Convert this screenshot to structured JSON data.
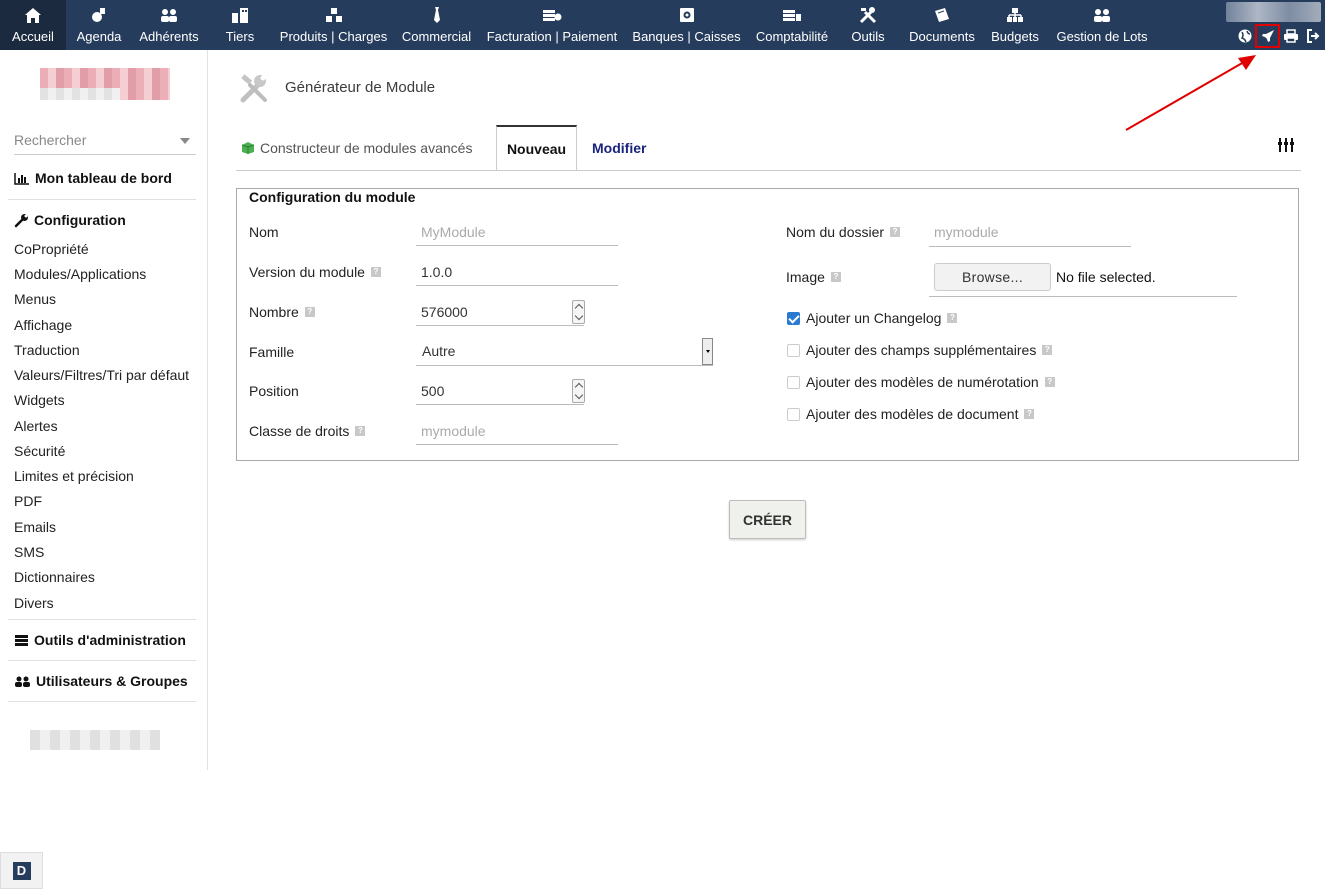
{
  "topbar": {
    "menu": [
      {
        "label": "Accueil",
        "icon": "home-icon"
      },
      {
        "label": "Agenda",
        "icon": "agenda-icon"
      },
      {
        "label": "Adhérents",
        "icon": "members-icon"
      },
      {
        "label": "Tiers",
        "icon": "building-icon"
      },
      {
        "label": "Produits | Charges",
        "icon": "products-icon"
      },
      {
        "label": "Commercial",
        "icon": "commercial-icon"
      },
      {
        "label": "Facturation | Paiement",
        "icon": "billing-icon"
      },
      {
        "label": "Banques | Caisses",
        "icon": "bank-icon"
      },
      {
        "label": "Comptabilité",
        "icon": "accounting-icon"
      },
      {
        "label": "Outils",
        "icon": "tools-icon"
      },
      {
        "label": "Documents",
        "icon": "documents-icon"
      },
      {
        "label": "Budgets",
        "icon": "budgets-icon"
      },
      {
        "label": "Gestion de Lots",
        "icon": "lots-icon"
      }
    ],
    "active": "Accueil",
    "right_icons": [
      "globe-icon",
      "rocket-icon",
      "print-icon",
      "logout-icon"
    ],
    "highlighted_icon": "rocket-icon"
  },
  "sidebar": {
    "search_placeholder": "Rechercher",
    "sections": {
      "dashboard": "Mon tableau de bord",
      "configuration": "Configuration",
      "admin_tools": "Outils d'administration",
      "users_groups": "Utilisateurs & Groupes"
    },
    "items": [
      "CoPropriété",
      "Modules/Applications",
      "Menus",
      "Affichage",
      "Traduction",
      "Valeurs/Filtres/Tri par défaut",
      "Widgets",
      "Alertes",
      "Sécurité",
      "Limites et précision",
      "PDF",
      "Emails",
      "SMS",
      "Dictionnaires",
      "Divers"
    ]
  },
  "main": {
    "title": "Générateur de Module",
    "tabs": {
      "advanced": "Constructeur de modules avancés",
      "new": "Nouveau",
      "modify": "Modifier"
    },
    "active_tab": "Nouveau",
    "fieldset_legend": "Configuration du module",
    "form": {
      "nom_label": "Nom",
      "nom_placeholder": "MyModule",
      "version_label": "Version du module",
      "version_value": "1.0.0",
      "nombre_label": "Nombre",
      "nombre_value": "576000",
      "famille_label": "Famille",
      "famille_value": "Autre",
      "position_label": "Position",
      "position_value": "500",
      "classe_label": "Classe de droits",
      "classe_placeholder": "mymodule",
      "dossier_label": "Nom du dossier",
      "dossier_placeholder": "mymodule",
      "image_label": "Image",
      "browse_label": "Browse...",
      "file_status": "No file selected.",
      "checkboxes": [
        {
          "label": "Ajouter un Changelog",
          "checked": true
        },
        {
          "label": "Ajouter des champs supplémentaires",
          "checked": false
        },
        {
          "label": "Ajouter des modèles de numérotation",
          "checked": false
        },
        {
          "label": "Ajouter des modèles de document",
          "checked": false
        }
      ]
    },
    "create_button": "CRÉER"
  },
  "colors": {
    "topbar_bg": "#263c5c",
    "active_tab_bg": "#1b2a3f",
    "annotation_red": "#e00000",
    "modify_tab": "#1a237e",
    "checkbox_checked": "#2a7ad1"
  }
}
